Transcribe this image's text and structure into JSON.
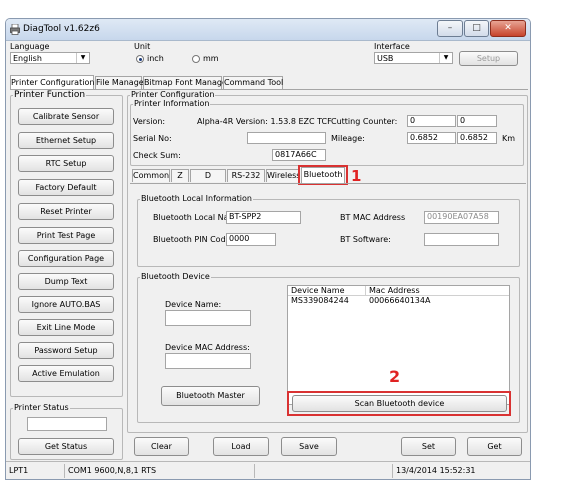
{
  "window": {
    "title": "DiagTool v1.62z6",
    "minimize": "–",
    "maximize": "□",
    "close": "✕"
  },
  "language": {
    "label": "Language",
    "value": "English"
  },
  "unit": {
    "label": "Unit",
    "inch": "inch",
    "mm": "mm",
    "selected": "inch"
  },
  "interface": {
    "label": "Interface",
    "value": "USB",
    "setup": "Setup"
  },
  "main_tabs": [
    "Printer Configuration",
    "File Manager",
    "Bitmap Font Manager",
    "Command Tool"
  ],
  "printer_function": {
    "label": "Printer Function",
    "buttons": [
      "Calibrate Sensor",
      "Ethernet Setup",
      "RTC Setup",
      "Factory Default",
      "Reset Printer",
      "Print Test Page",
      "Configuration Page",
      "Dump Text",
      "Ignore AUTO.BAS",
      "Exit Line Mode",
      "Password Setup",
      "Active Emulation"
    ]
  },
  "printer_status": {
    "label": "Printer Status",
    "get_status": "Get Status"
  },
  "printer_configuration": {
    "label": "Printer Configuration",
    "info_label": "Printer Information",
    "version_label": "Version:",
    "version_value": "Alpha-4R Version: 1.53.8 EZC TCF",
    "cutting_counter_label": "Cutting Counter:",
    "cutting_counter_1": "0",
    "cutting_counter_2": "0",
    "serial_label": "Serial No:",
    "serial_value": "",
    "mileage_label": "Mileage:",
    "mileage_1": "0.6852",
    "mileage_2": "0.6852",
    "mileage_unit": "Km",
    "checksum_label": "Check Sum:",
    "checksum_value": "0817A66C"
  },
  "sub_tabs": [
    "Common",
    "Z",
    "D",
    "RS-232",
    "Wireless",
    "Bluetooth"
  ],
  "bluetooth_local": {
    "label": "Bluetooth Local Information",
    "local_name_label": "Bluetooth Local Nam",
    "local_name_value": "BT-SPP2",
    "pin_label": "Bluetooth PIN Code",
    "pin_value": "0000",
    "mac_label": "BT MAC Address",
    "mac_value": "00190EA07A58",
    "software_label": "BT Software:",
    "software_value": ""
  },
  "bluetooth_device": {
    "label": "Bluetooth Device",
    "device_name_label": "Device Name:",
    "device_name_value": "",
    "device_mac_label": "Device MAC Address:",
    "device_mac_value": "",
    "bt_master_button": "Bluetooth Master",
    "columns": [
      "Device Name",
      "Mac Address"
    ],
    "rows": [
      [
        "MS339084244",
        "00066640134A"
      ]
    ],
    "scan_button": "Scan Bluetooth device"
  },
  "bottom_buttons": {
    "clear": "Clear",
    "load": "Load",
    "save": "Save",
    "set": "Set",
    "get": "Get"
  },
  "annotations": {
    "one": "1",
    "two": "2"
  },
  "status_bar": {
    "port": "LPT1",
    "com": "COM1 9600,N,8,1 RTS",
    "empty": "",
    "datetime": "13/4/2014 15:52:31"
  },
  "colors": {
    "annotation_red": "#d93232",
    "title_gradient": "#c7d7ec",
    "close_red": "#c7432c"
  }
}
